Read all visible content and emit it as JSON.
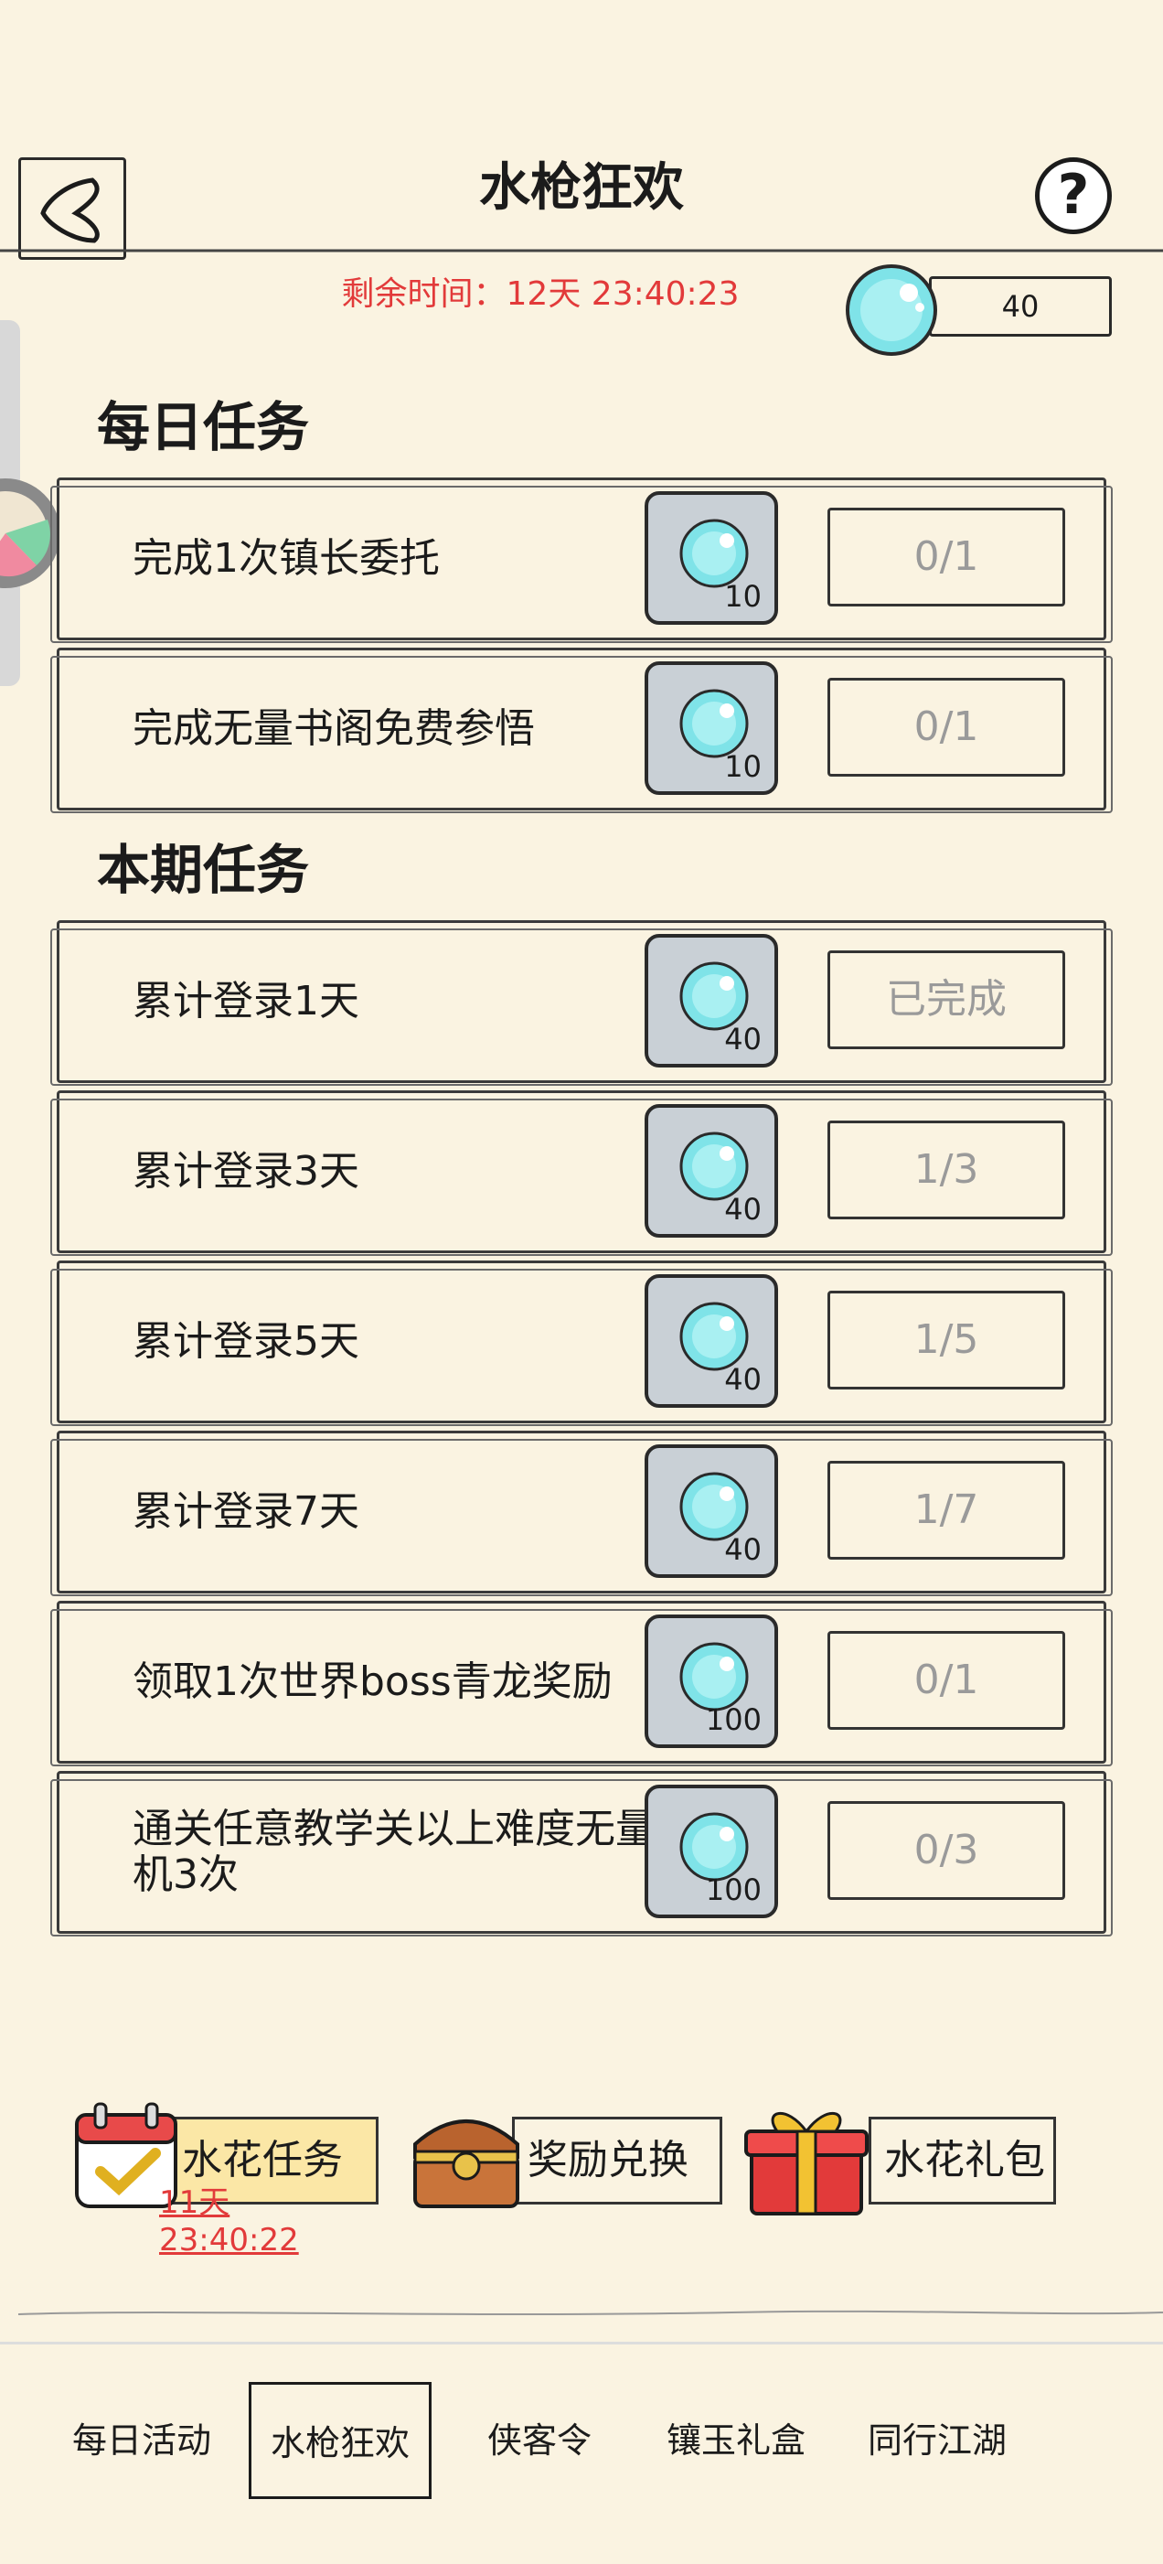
{
  "header": {
    "title": "水枪狂欢",
    "help_symbol": "?",
    "timer": "剩余时间：12天 23:40:23",
    "balance": "40"
  },
  "sections": {
    "daily_title": "每日任务",
    "period_title": "本期任务"
  },
  "daily_tasks": [
    {
      "label": "完成1次镇长委托",
      "reward": "10",
      "status": "0/1"
    },
    {
      "label": "完成无量书阁免费参悟",
      "reward": "10",
      "status": "0/1"
    }
  ],
  "period_tasks": [
    {
      "label": "累计登录1天",
      "reward": "40",
      "status": "已完成"
    },
    {
      "label": "累计登录3天",
      "reward": "40",
      "status": "1/3"
    },
    {
      "label": "累计登录5天",
      "reward": "40",
      "status": "1/5"
    },
    {
      "label": "累计登录7天",
      "reward": "40",
      "status": "1/7"
    },
    {
      "label": "领取1次世界boss青龙奖励",
      "reward": "100",
      "status": "0/1"
    },
    {
      "label": "通关任意教学关以上难度无量天机3次",
      "reward": "100",
      "status": "0/3"
    }
  ],
  "bottom_buttons": {
    "splash_tasks": "水花任务",
    "splash_timer": "11天 23:40:22",
    "reward_exchange": "奖励兑换",
    "splash_gift": "水花礼包"
  },
  "tabs": [
    "每日活动",
    "水枪狂欢",
    "侠客令",
    "镶玉礼盒",
    "同行江湖"
  ],
  "colors": {
    "background": "#faf3e1",
    "timer_red": "#e23a3a",
    "gem_cyan": "#7fe3e8",
    "reward_bg": "#c9d0d6"
  }
}
